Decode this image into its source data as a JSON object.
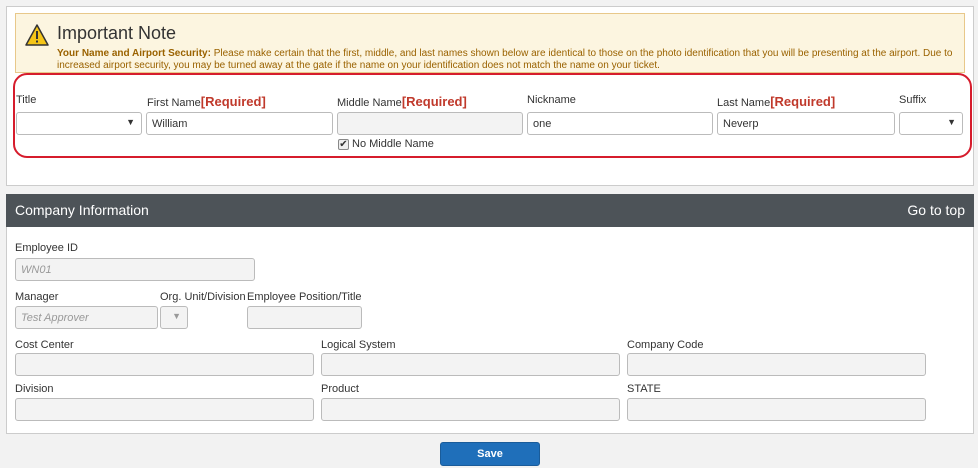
{
  "note": {
    "title": "Important Note",
    "lead": "Your Name and Airport Security:",
    "body": " Please make certain that the first, middle, and last names shown below are identical to those on the photo identification that you will be presenting at the airport. Due to increased airport security, you may be turned away at the gate if the name on your identification does not match the name on your ticket."
  },
  "name_fields": {
    "title_label": "Title",
    "first_label": "First Name",
    "first_required": "[Required]",
    "first_value": "William",
    "middle_label": "Middle Name",
    "middle_required": "[Required]",
    "middle_value": "",
    "nickname_label": "Nickname",
    "nickname_value": "one",
    "last_label": "Last Name",
    "last_required": "[Required]",
    "last_value": "Neverp",
    "suffix_label": "Suffix",
    "no_middle_label": "No Middle Name",
    "no_middle_checked": "✔"
  },
  "company": {
    "header": "Company Information",
    "goto_top": "Go to top",
    "employee_id_label": "Employee ID",
    "employee_id_value": "WN01",
    "manager_label": "Manager",
    "manager_value": "Test Approver",
    "org_unit_label": "Org. Unit/Division",
    "position_label": "Employee Position/Title",
    "cost_center_label": "Cost Center",
    "logical_system_label": "Logical System",
    "company_code_label": "Company Code",
    "division_label": "Division",
    "product_label": "Product",
    "state_label": "STATE"
  },
  "actions": {
    "save": "Save"
  },
  "colors": {
    "required": "#c0392b",
    "highlight_ring": "#d61c2c",
    "header_bg": "#4d5358",
    "save_bg": "#1f6fba"
  }
}
